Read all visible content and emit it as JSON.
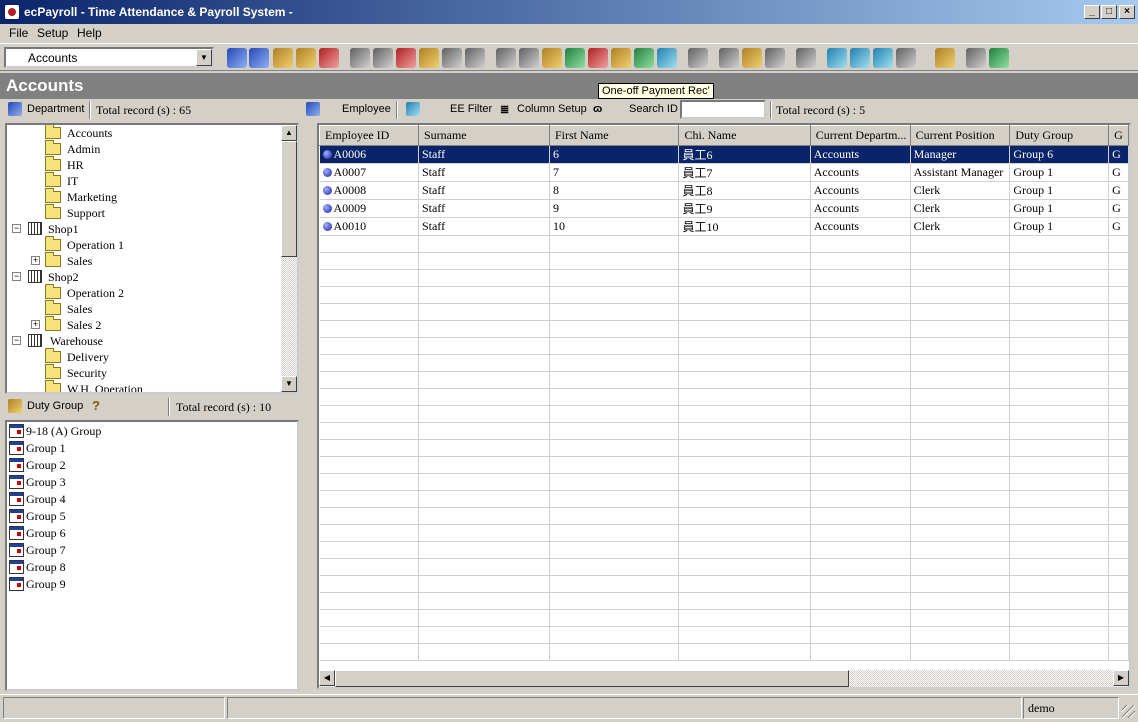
{
  "window": {
    "title": "ecPayroll - Time Attendance & Payroll System -"
  },
  "menu": [
    "File",
    "Setup",
    "Help"
  ],
  "toolbar": {
    "department_select": "Accounts"
  },
  "header": {
    "title": "Accounts",
    "tooltip": "One-off Payment Rec'"
  },
  "dept_panel": {
    "label": "Department",
    "total": "Total record (s) : 65"
  },
  "tree": [
    {
      "label": "Accounts"
    },
    {
      "label": "Admin"
    },
    {
      "label": "HR"
    },
    {
      "label": "IT"
    },
    {
      "label": "Marketing"
    },
    {
      "label": "Support"
    },
    {
      "label": "Shop1"
    },
    {
      "label": "Operation 1"
    },
    {
      "label": "Sales"
    },
    {
      "label": "Shop2"
    },
    {
      "label": "Operation 2"
    },
    {
      "label": "Sales"
    },
    {
      "label": "Sales 2"
    },
    {
      "label": "Warehouse"
    },
    {
      "label": "Delivery"
    },
    {
      "label": "Security"
    },
    {
      "label": "W.H. Operation"
    }
  ],
  "duty_panel": {
    "label": "Duty Group",
    "total": "Total record (s) : 10"
  },
  "duty_groups": [
    "9-18 (A) Group",
    "Group 1",
    "Group 2",
    "Group 3",
    "Group 4",
    "Group 5",
    "Group 6",
    "Group 7",
    "Group 8",
    "Group 9"
  ],
  "emp_bar": {
    "employee": "Employee",
    "filter": "EE Filter",
    "column_setup": "Column Setup",
    "search_label": "Search ID",
    "search_value": "",
    "total": "Total record (s) : 5"
  },
  "grid": {
    "columns": [
      "Employee ID",
      "Surname",
      "First Name",
      "Chi. Name",
      "Current Departm...",
      "Current Position",
      "Duty Group",
      "G"
    ],
    "rows": [
      [
        "A0006",
        "Staff",
        "6",
        "員工6",
        "Accounts",
        "Manager",
        "Group 6",
        "G"
      ],
      [
        "A0007",
        "Staff",
        "7",
        "員工7",
        "Accounts",
        "Assistant Manager",
        "Group 1",
        "G"
      ],
      [
        "A0008",
        "Staff",
        "8",
        "員工8",
        "Accounts",
        "Clerk",
        "Group 1",
        "G"
      ],
      [
        "A0009",
        "Staff",
        "9",
        "員工9",
        "Accounts",
        "Clerk",
        "Group 1",
        "G"
      ],
      [
        "A0010",
        "Staff",
        "10",
        "員工10",
        "Accounts",
        "Clerk",
        "Group 1",
        "G"
      ]
    ],
    "selected_row": 0
  },
  "status": {
    "user": "demo"
  }
}
